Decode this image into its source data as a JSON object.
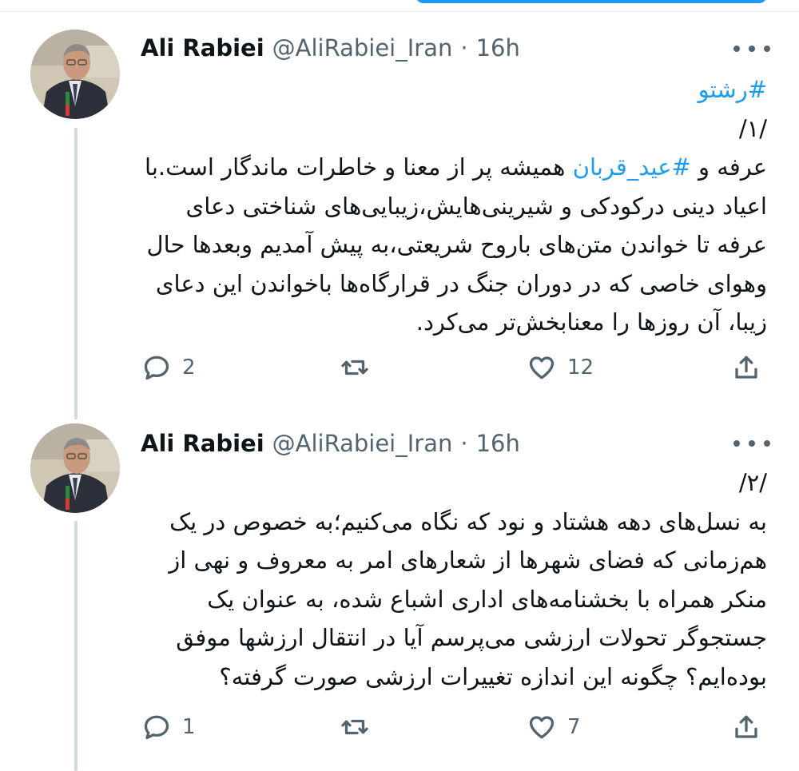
{
  "tweets": [
    {
      "author_name": "Ali Rabiei",
      "handle": "@AliRabiei_Iran",
      "separator": "·",
      "time": "16h",
      "hashtag_line": "#رشتو",
      "number_line": "/۱/",
      "body_lines": [
        {
          "before": "عرفه و ",
          "tag": "#عید_قربان",
          "after": " همیشه پر از معنا و خاطرات ماندگار است.با"
        },
        {
          "text": "اعیاد دینی درکودکی و شیرینی‌هایش،زیبایی‌های شناختی دعای"
        },
        {
          "text": "عرفه تا خواندن متن‌های باروح شریعتی،به پیش آمدیم وبعدها حال"
        },
        {
          "text": "وهوای خاصی که در دوران جنگ در قرارگاه‌ها باخواندن این دعای"
        },
        {
          "text": "زیبا، آن روزها را معنابخش‌تر می‌کرد."
        }
      ],
      "reply_count": "2",
      "retweet_count": "",
      "like_count": "12"
    },
    {
      "author_name": "Ali Rabiei",
      "handle": "@AliRabiei_Iran",
      "separator": "·",
      "time": "16h",
      "number_line": "/۲/",
      "body_lines": [
        {
          "text": "به نسل‌های دهه هشتاد و نود که نگاه می‌کنیم؛به خصوص در یک"
        },
        {
          "text": "هم‌زمانی که فضای شهرها از شعارهای امر به معروف و نهی از"
        },
        {
          "text": "منکر همراه با بخشنامه‌های اداری اشباع شده، به عنوان یک"
        },
        {
          "text": "جستجوگر تحولات ارزشی می‌پرسم آیا در انتقال ارزشها موفق"
        },
        {
          "text": "بوده‌ایم؟ چگونه این اندازه تغییرات ارزشی صورت گرفته؟"
        }
      ],
      "reply_count": "1",
      "retweet_count": "",
      "like_count": "7"
    }
  ],
  "icons": {
    "more": "more-horizontal-icon",
    "reply": "reply-icon",
    "retweet": "retweet-icon",
    "like": "heart-icon",
    "share": "share-icon"
  },
  "colors": {
    "link": "#1d9bf0",
    "muted": "#536471",
    "text": "#0f1419",
    "thread_line": "#cfd9de"
  }
}
